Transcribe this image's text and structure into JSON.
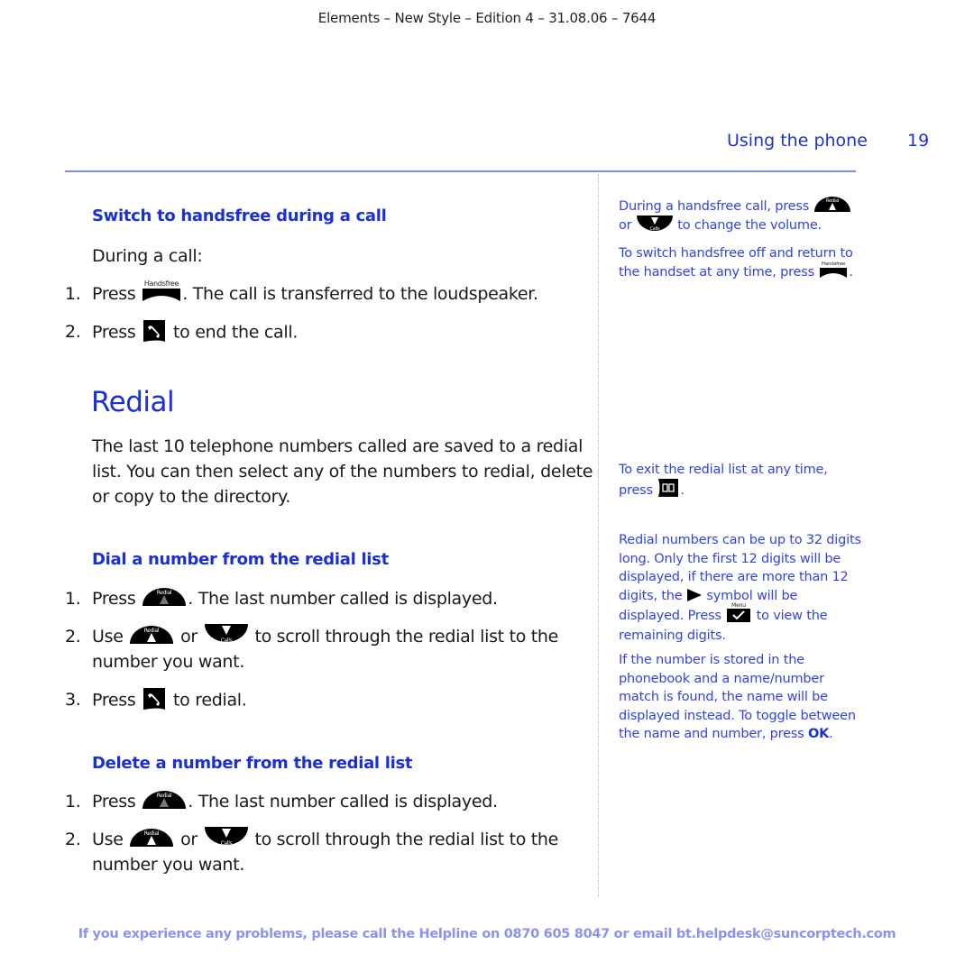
{
  "header": {
    "text": "Elements – New Style – Edition 4 – 31.08.06 – 7644"
  },
  "running_head": {
    "section": "Using the phone",
    "page_number": "19"
  },
  "handsfree": {
    "title": "Switch to handsfree during a call",
    "intro": "During a call:",
    "steps": [
      {
        "num": "1.",
        "pre": "Press",
        "post": ". The call is transferred to the loudspeaker."
      },
      {
        "num": "2.",
        "pre": "Press",
        "post": "to end the call."
      }
    ]
  },
  "redial": {
    "title": "Redial",
    "para": [
      "The last 10 telephone numbers called are saved to a redial",
      "list. You can then select any of the numbers to redial, delete",
      "or copy to the directory."
    ]
  },
  "dial": {
    "title": "Dial a number from the redial list",
    "steps": [
      {
        "num": "1.",
        "pre": "Press",
        "post": ". The last number called is displayed."
      },
      {
        "num": "2.",
        "pre": "Use",
        "mid": "or",
        "post": "to scroll through the redial list to the",
        "line2": "number you want."
      },
      {
        "num": "3.",
        "pre": "Press",
        "post": "to redial."
      }
    ]
  },
  "delete": {
    "title": "Delete a number from the redial list",
    "steps": [
      {
        "num": "1.",
        "pre": "Press",
        "post": ". The last number called is displayed."
      },
      {
        "num": "2.",
        "pre": "Use",
        "mid": "or",
        "post": "to scroll through the redial list to the",
        "line2": "number you want."
      }
    ]
  },
  "sidebar": {
    "volume": {
      "a": "During a handsfree call, press",
      "b_pre": "or",
      "b_post": "to change the volume."
    },
    "handset": {
      "a": "To switch handsfree off and return to",
      "b": "the handset at any time, press",
      "end": "."
    },
    "exit": {
      "a": "To exit the redial list at any time,",
      "b": "press",
      "end": "."
    },
    "digits": {
      "l1": "Redial numbers can be up to 32 digits",
      "l2": "long. Only the first 12 digits will be",
      "l3": "displayed, if there are more than 12",
      "l4a": "digits, the",
      "l4b": "symbol will be",
      "l5a": "displayed. Press",
      "l5b": "to view the",
      "l6": "remaining digits."
    },
    "phonebook": {
      "l1": "If the number is stored in the",
      "l2": "phonebook and a name/number",
      "l3": "match is found, the name will be",
      "l4": "displayed instead. To toggle between",
      "l5": "the name and number, press",
      "ok": "OK",
      "end": "."
    }
  },
  "icons": {
    "handsfree_label": "Handsfree",
    "redial_label": "Redial",
    "calls_label": "Calls",
    "menu_label": "Menu"
  },
  "footer": {
    "text": "If you experience any problems, please call the Helpline on 0870 605 8047 or email bt.helpdesk@suncorptech.com"
  }
}
